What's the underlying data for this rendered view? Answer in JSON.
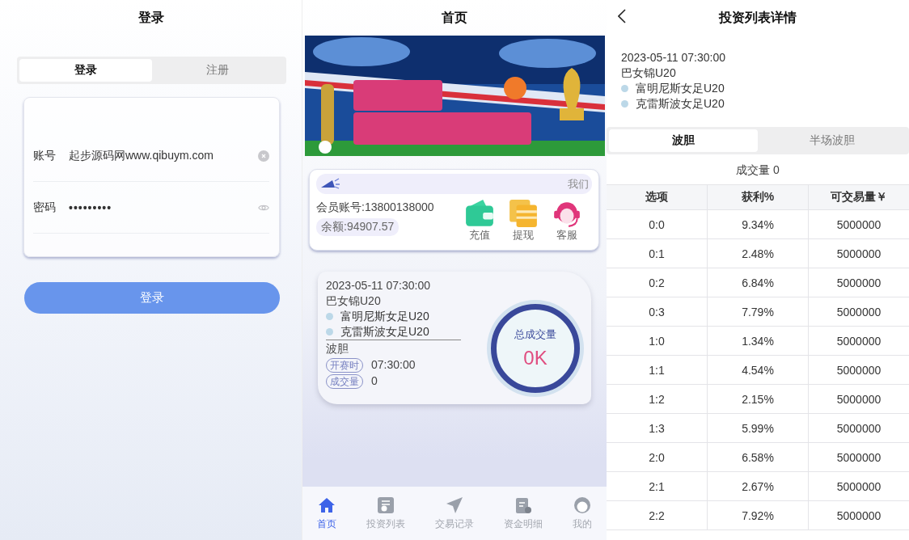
{
  "login": {
    "title": "登录",
    "tabs": [
      {
        "label": "登录",
        "selected": true
      },
      {
        "label": "注册",
        "selected": false
      }
    ],
    "fields": [
      {
        "label": "账号",
        "value": "起步源码网www.qibuym.com",
        "kind": "text"
      },
      {
        "label": "密码",
        "value": "•••••••••",
        "kind": "password"
      }
    ],
    "button": "登录"
  },
  "home": {
    "title": "首页",
    "notice": "我们",
    "account": "会员账号:13800138000",
    "balance": "余额:94907.57",
    "actions": [
      {
        "label": "充值",
        "kind": "wallet"
      },
      {
        "label": "提现",
        "kind": "cards"
      },
      {
        "label": "客服",
        "kind": "support"
      }
    ],
    "match": {
      "time": "2023-05-11 07:30:00",
      "league": "巴女锦U20",
      "teams": [
        "富明尼斯女足U20",
        "克雷斯波女足U20"
      ],
      "market": "波胆",
      "kickoff_label": "开赛时",
      "kickoff": "07:30:00",
      "volume_label": "成交量",
      "volume": "0",
      "ring_label": "总成交量",
      "ring_value": "0K"
    },
    "nav": [
      {
        "label": "首页",
        "kind": "home",
        "selected": true
      },
      {
        "label": "投资列表",
        "kind": "list",
        "selected": false
      },
      {
        "label": "交易记录",
        "kind": "send",
        "selected": false
      },
      {
        "label": "资金明细",
        "kind": "clipboard",
        "selected": false
      },
      {
        "label": "我的",
        "kind": "face",
        "selected": false
      }
    ]
  },
  "detail": {
    "title": "投资列表详情",
    "time": "2023-05-11 07:30:00",
    "league": "巴女锦U20",
    "teams": [
      "富明尼斯女足U20",
      "克雷斯波女足U20"
    ],
    "tabs": [
      {
        "label": "波胆",
        "selected": true
      },
      {
        "label": "半场波胆",
        "selected": false
      }
    ],
    "volume": "成交量 0",
    "table": {
      "columns": [
        "选项",
        "获利%",
        "可交易量￥"
      ],
      "rows": [
        [
          "0:0",
          "9.34%",
          "5000000"
        ],
        [
          "0:1",
          "2.48%",
          "5000000"
        ],
        [
          "0:2",
          "6.84%",
          "5000000"
        ],
        [
          "0:3",
          "7.79%",
          "5000000"
        ],
        [
          "1:0",
          "1.34%",
          "5000000"
        ],
        [
          "1:1",
          "4.54%",
          "5000000"
        ],
        [
          "1:2",
          "2.15%",
          "5000000"
        ],
        [
          "1:3",
          "5.99%",
          "5000000"
        ],
        [
          "2:0",
          "6.58%",
          "5000000"
        ],
        [
          "2:1",
          "2.67%",
          "5000000"
        ],
        [
          "2:2",
          "7.92%",
          "5000000"
        ]
      ]
    }
  }
}
